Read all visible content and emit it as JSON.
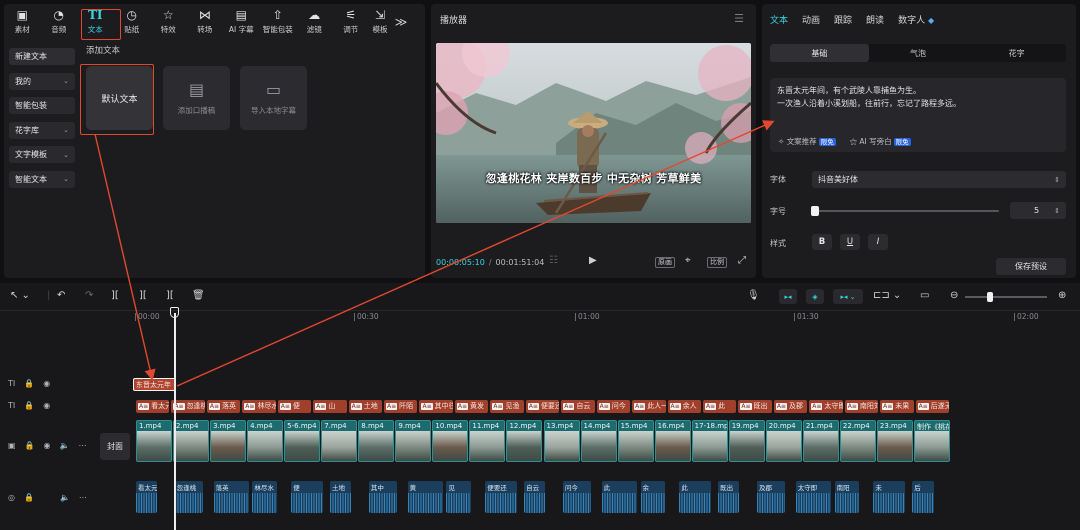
{
  "colors": {
    "accent": "#38d6e0",
    "annotation_red": "#e1482f",
    "text_clip": "#a0402c",
    "video_clip": "#1d6b6e",
    "audio_clip": "#1b3e5c"
  },
  "toolbar": {
    "tabs": [
      {
        "label": "素材",
        "icon": "media-icon"
      },
      {
        "label": "音频",
        "icon": "audio-icon"
      },
      {
        "label": "文本",
        "icon": "text-icon",
        "active": true
      },
      {
        "label": "贴纸",
        "icon": "sticker-icon"
      },
      {
        "label": "特效",
        "icon": "effects-icon"
      },
      {
        "label": "转场",
        "icon": "transition-icon"
      },
      {
        "label": "AI 字幕",
        "icon": "ai-caption-icon"
      },
      {
        "label": "智能包装",
        "icon": "smart-pack-icon"
      },
      {
        "label": "滤镜",
        "icon": "filter-icon"
      },
      {
        "label": "调节",
        "icon": "adjust-icon"
      },
      {
        "label": "模板",
        "icon": "template-icon"
      }
    ],
    "more": "≫"
  },
  "side_menu": [
    {
      "label": "新建文本",
      "chevron": false,
      "active": true
    },
    {
      "label": "我的",
      "chevron": true
    },
    {
      "label": "智能包装",
      "chevron": false
    },
    {
      "label": "花字库",
      "chevron": true
    },
    {
      "label": "文字模板",
      "chevron": true
    },
    {
      "label": "智能文本",
      "chevron": true
    }
  ],
  "add_text": {
    "title": "添加文本",
    "cards": [
      {
        "label": "默认文本",
        "icon": ""
      },
      {
        "label": "添加口播稿",
        "icon": "script-icon"
      },
      {
        "label": "导入本地字幕",
        "icon": "folder-icon"
      }
    ]
  },
  "player": {
    "title": "播放器",
    "subtitle": "忽逢桃花林 夹岸数百步 中无杂树 芳草鲜美",
    "current_time": "00:00:05:10",
    "separator": "/",
    "total_time": "00:01:51:04",
    "btn_original": "原画",
    "btn_ratio": "比例"
  },
  "props": {
    "tabs": [
      "文本",
      "动画",
      "跟踪",
      "朗读",
      "数字人"
    ],
    "sub_tabs": [
      "基础",
      "气泡",
      "花字"
    ],
    "text_content": "东晋太元年间，有个武陵人靠捕鱼为生。\n一次渔人沿着小溪划船，往前行，忘记了路程多远。",
    "tool_recommend": "文案推荐",
    "tool_ai_write": "AI 写旁白",
    "badge": "限免",
    "font_label": "字体",
    "font_value": "抖音美好体",
    "size_label": "字号",
    "size_value": "5",
    "size_fraction": 0.0,
    "style_label": "样式",
    "style_bold": "B",
    "style_underline": "U",
    "style_italic": "I",
    "save_preset": "保存预设"
  },
  "timeline": {
    "ticks": [
      "00:00",
      "00:30",
      "01:00",
      "01:30",
      "02:00"
    ],
    "zoom_fraction": 0.3,
    "cover_label": "封面",
    "selected_text": "东晋太元年",
    "caption_clips": [
      "看太元",
      "忽逢桃",
      "落英",
      "林尽水",
      "便",
      "山",
      "土地",
      "阡陌",
      "其中往",
      "黄发",
      "见渔",
      "便要还",
      "自云",
      "问今",
      "此人一",
      "余人",
      "此",
      "既出",
      "及郡",
      "太守即",
      "南阳刘",
      "未果",
      "后遂无"
    ],
    "video_clips": [
      "1.mp4",
      "2.mp4",
      "3.mp4",
      "4.mp4",
      "5-6.mp4",
      "7.mp4",
      "8.mp4",
      "9.mp4",
      "10.mp4",
      "11.mp4",
      "12.mp4",
      "13.mp4",
      "14.mp4",
      "15.mp4",
      "16.mp4",
      "17-18.mp4",
      "19.mp4",
      "20.mp4",
      "21.mp4",
      "22.mp4",
      "23.mp4",
      "制作《桃花"
    ],
    "audio_clips": [
      "看太元",
      "忽逢桃",
      "落英",
      "林尽水",
      "便",
      "土地",
      "其中",
      "黄",
      "见",
      "便要还",
      "自云",
      "问今",
      "此",
      "余",
      "此",
      "既出",
      "及郡",
      "太守即",
      "南阳",
      "未",
      "后"
    ]
  }
}
